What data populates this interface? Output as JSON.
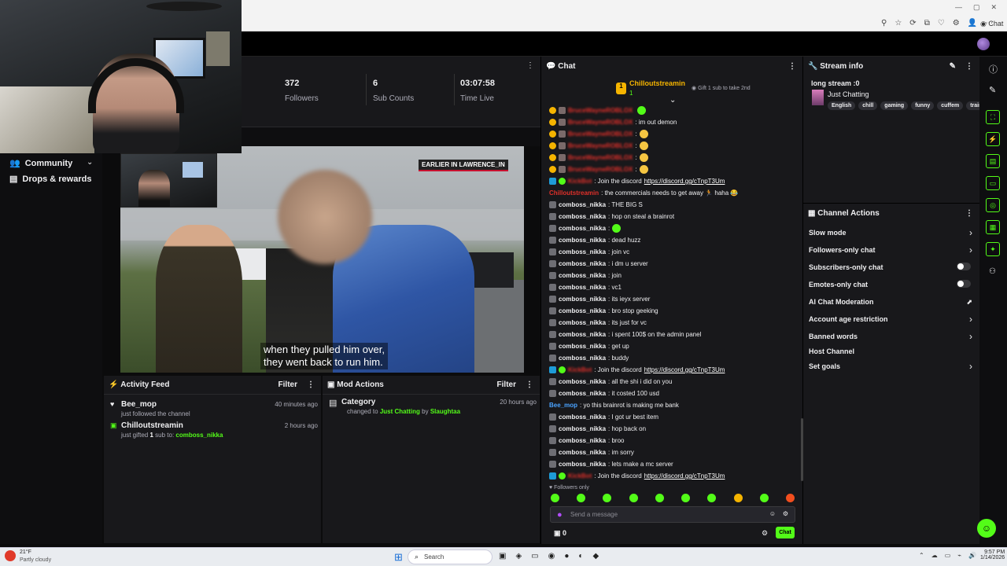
{
  "browser": {
    "tab_label": "Chat"
  },
  "stats": [
    {
      "value": "372",
      "label": "Followers"
    },
    {
      "value": "6",
      "label": "Sub Counts"
    },
    {
      "value": "03:07:58",
      "label": "Time Live"
    }
  ],
  "sidebar": {
    "items": [
      {
        "label": "Community"
      },
      {
        "label": "Drops & rewards"
      }
    ]
  },
  "video": {
    "caption_line1": "when they pulled him over,",
    "caption_line2": "they went back to run him.",
    "tag": "EARLIER IN LAWRENCE_IN"
  },
  "activity": {
    "title": "Activity Feed",
    "filter": "Filter",
    "items": [
      {
        "name": "Bee_mop",
        "sub": "just followed the channel",
        "time": "40 minutes ago"
      },
      {
        "name": "Chilloutstreamin",
        "sub_prefix": "just gifted ",
        "sub_count": "1",
        "sub_mid": " sub to: ",
        "sub_user": "comboss_nikka",
        "time": "2 hours ago"
      }
    ]
  },
  "modactions": {
    "title": "Mod Actions",
    "filter": "Filter",
    "item": {
      "name": "Category",
      "pre": "changed to ",
      "cat": "Just Chatting",
      "by": " by ",
      "user": "Slaughtaa",
      "time": "20 hours ago"
    }
  },
  "chat": {
    "title": "Chat",
    "pinned_user": "Chilloutstreamin",
    "pinned_count": "1",
    "pinned_goal": "Gift 1 sub to take 2nd",
    "followers_only": "Followers only",
    "input_placeholder": "Send a message",
    "send_label": "Chat",
    "points": "0",
    "messages": [
      {
        "user": "BruceWayneROBLOX",
        "text": "",
        "emote": true,
        "badges": true
      },
      {
        "user": "BruceWayneROBLOX",
        "text": ": im out demon",
        "badges": true
      },
      {
        "user": "BruceWayneROBLOX",
        "text": ":",
        "emote": true,
        "badges": true
      },
      {
        "user": "BruceWayneROBLOX",
        "text": ":",
        "emote": true,
        "badges": true
      },
      {
        "user": "BruceWayneROBLOX",
        "text": ":",
        "emote": true,
        "badges": true
      },
      {
        "user": "BruceWayneROBLOX",
        "text": ":",
        "emote": true,
        "badges": true
      },
      {
        "user": "KickBot",
        "text": ": Join the discord ",
        "link": "https://discord.gg/cTnpT3Um",
        "bot": true
      },
      {
        "user": "Chilloutstreamin",
        "text": ": the commercials needs to get away 🏃 haha 😂",
        "host": true
      },
      {
        "user": "comboss_nikka",
        "text": ": THE BIG S"
      },
      {
        "user": "comboss_nikka",
        "text": ": hop on steal a brainrot"
      },
      {
        "user": "comboss_nikka",
        "text": ":",
        "emote": true
      },
      {
        "user": "comboss_nikka",
        "text": ": dead huzz"
      },
      {
        "user": "comboss_nikka",
        "text": ": join vc"
      },
      {
        "user": "comboss_nikka",
        "text": ": i dm u server"
      },
      {
        "user": "comboss_nikka",
        "text": ": join"
      },
      {
        "user": "comboss_nikka",
        "text": ": vc1"
      },
      {
        "user": "comboss_nikka",
        "text": ": its ieyx server"
      },
      {
        "user": "comboss_nikka",
        "text": ": bro stop geeking"
      },
      {
        "user": "comboss_nikka",
        "text": ": its just for vc"
      },
      {
        "user": "comboss_nikka",
        "text": ": i spent 100$ on the admin panel"
      },
      {
        "user": "comboss_nikka",
        "text": ": get up"
      },
      {
        "user": "comboss_nikka",
        "text": ": buddy"
      },
      {
        "user": "KickBot",
        "text": ": Join the discord ",
        "link": "https://discord.gg/cTnpT3Um",
        "bot": true
      },
      {
        "user": "comboss_nikka",
        "text": ": all the shi i did on you"
      },
      {
        "user": "comboss_nikka",
        "text": ": it costed 100 usd"
      },
      {
        "user": "Bee_mop",
        "text": ": yo this brainrot is making me bank",
        "blue": true
      },
      {
        "user": "comboss_nikka",
        "text": ": I got ur best item"
      },
      {
        "user": "comboss_nikka",
        "text": ": hop back on"
      },
      {
        "user": "comboss_nikka",
        "text": ": broo"
      },
      {
        "user": "comboss_nikka",
        "text": ": im sorry"
      },
      {
        "user": "comboss_nikka",
        "text": ": lets make a mc server"
      },
      {
        "user": "KickBot",
        "text": ": Join the discord ",
        "link": "https://discord.gg/cTnpT3Um",
        "bot": true
      }
    ]
  },
  "stream_info": {
    "title": "Stream info",
    "stream_title": "long stream :0",
    "category": "Just Chatting",
    "tags": [
      "English",
      "chill",
      "gaming",
      "funny",
      "cuffem",
      "trainwreck"
    ]
  },
  "channel_actions": {
    "title": "Channel Actions",
    "items": [
      {
        "label": "Slow mode",
        "kind": "arrow"
      },
      {
        "label": "Followers-only chat",
        "kind": "arrow"
      },
      {
        "label": "Subscribers-only chat",
        "kind": "toggle"
      },
      {
        "label": "Emotes-only chat",
        "kind": "toggle"
      },
      {
        "label": "AI Chat Moderation",
        "kind": "chart"
      },
      {
        "label": "Account age restriction",
        "kind": "arrow"
      },
      {
        "label": "Banned words",
        "kind": "arrow"
      },
      {
        "label": "Host Channel",
        "kind": "none"
      },
      {
        "label": "Set goals",
        "kind": "arrow"
      }
    ]
  },
  "taskbar": {
    "weather_temp": "21°F",
    "weather_desc": "Partly cloudy",
    "search": "Search",
    "time": "9:57 PM",
    "date": "1/14/2026"
  },
  "colors": {
    "accent": "#53fc18",
    "bg": "#18181b",
    "user_red": "#e0302a",
    "user_blue": "#4aa3ff"
  }
}
